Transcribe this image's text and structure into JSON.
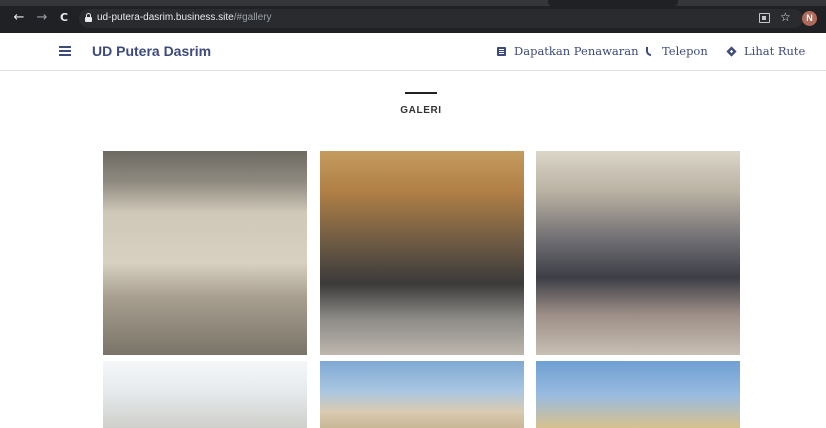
{
  "browser": {
    "url_host": "ud-putera-dasrim.business.site",
    "url_path": "/#gallery",
    "profile_initial": "N",
    "nav": {
      "back": "←",
      "forward": "→",
      "reload": "C"
    }
  },
  "header": {
    "brand": "UD Putera Dasrim",
    "links": [
      {
        "label": "Dapatkan Penawaran",
        "icon": "quote-doc-icon"
      },
      {
        "label": "Telepon",
        "icon": "phone-icon"
      },
      {
        "label": "Lihat Rute",
        "icon": "directions-icon"
      }
    ]
  },
  "gallery": {
    "title": "GALERI",
    "tiles": [
      {
        "subject": "carved stone columns and panels"
      },
      {
        "subject": "stone fountains and granite grave marker"
      },
      {
        "subject": "stone lanterns and bench"
      },
      {
        "subject": "building facade"
      },
      {
        "subject": "ornamental gable"
      },
      {
        "subject": "mosque dome"
      }
    ]
  },
  "colors": {
    "brand": "#3c4a7c",
    "chrome_bg": "#202124"
  }
}
